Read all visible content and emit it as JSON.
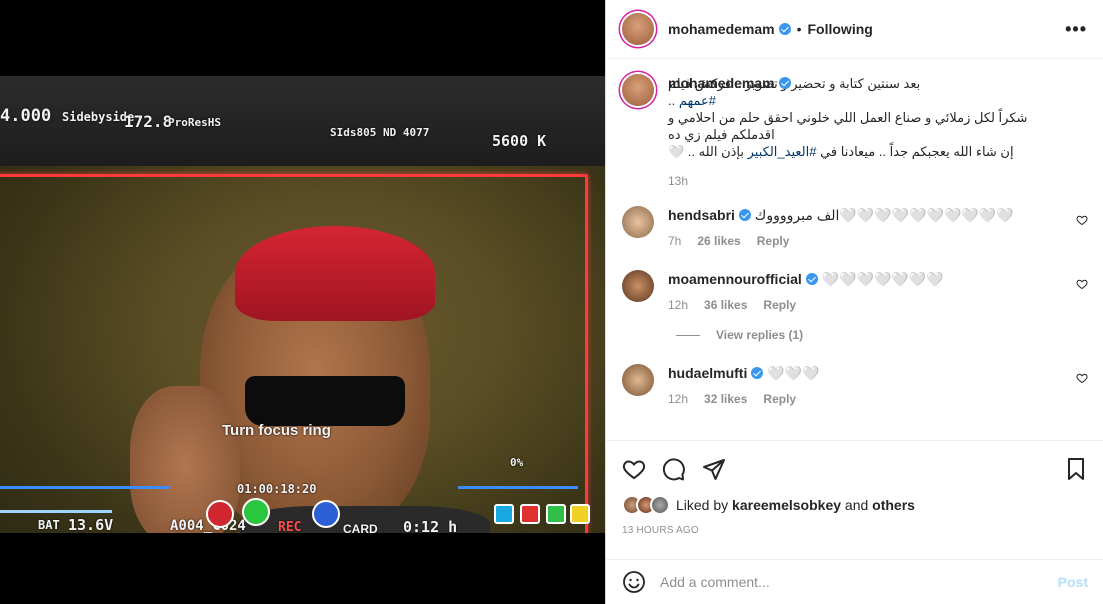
{
  "post": {
    "author": "mohamedemam",
    "follow_status": "Following",
    "more_label": "•••",
    "caption_line1_pre": "بعد سنتين كتابة و تحضير و تصوير .. فركش فيلم ",
    "caption_hashtag1": "#عمهم",
    "caption_line1_post": " ..",
    "caption_line2": "شكراً لكل زملائي و صناع العمل اللي خلوني احقق حلم من احلامي و اقدملكم فيلم زي ده",
    "caption_line3_pre": "إن شاء الله يعجبكم جداً .. ميعادنا في ",
    "caption_hashtag2": "#العيد_الكبير",
    "caption_line3_post": " بإذن الله .. 🤍",
    "caption_time": "13h",
    "liked_by_prefix": "Liked by",
    "liked_by_user": "kareemelsobkey",
    "liked_by_and": "and",
    "liked_by_others": "others",
    "posted_ago": "13 HOURS AGO"
  },
  "comments": [
    {
      "user": "hendsabri",
      "text": "الف مبرووووك🤍🤍🤍🤍🤍🤍🤍🤍🤍🤍",
      "time": "7h",
      "likes": "26 likes",
      "reply": "Reply"
    },
    {
      "user": "moamennourofficial",
      "text": "🤍🤍🤍🤍🤍🤍🤍",
      "time": "12h",
      "likes": "36 likes",
      "reply": "Reply",
      "view_replies": "View replies (1)"
    },
    {
      "user": "hudaelmufti",
      "text": "🤍🤍🤍",
      "time": "12h",
      "likes": "32 likes",
      "reply": "Reply"
    }
  ],
  "add_comment": {
    "placeholder": "Add a comment...",
    "post_label": "Post"
  },
  "media": {
    "osd_left_value": "4.000",
    "osd_sidebyside": "Sidebyside",
    "osd_ratio": "172.8",
    "osd_res": "ProResHS",
    "osd_clip": "SIds805 ND 4077",
    "osd_kelvin": "5600 K",
    "osd_tc": "01:00:18:20",
    "osd_bat": "BAT",
    "osd_bat_value": "13.6V",
    "osd_reel": "A004_C024",
    "osd_rec": "REC",
    "osd_card": "CARD",
    "osd_remaining": "0:12 h",
    "osd_focus_msg": "Turn focus ring",
    "osd_percent": "0%"
  },
  "colors": {
    "accent": "#3897f0",
    "rec": "#ff3a3a"
  }
}
